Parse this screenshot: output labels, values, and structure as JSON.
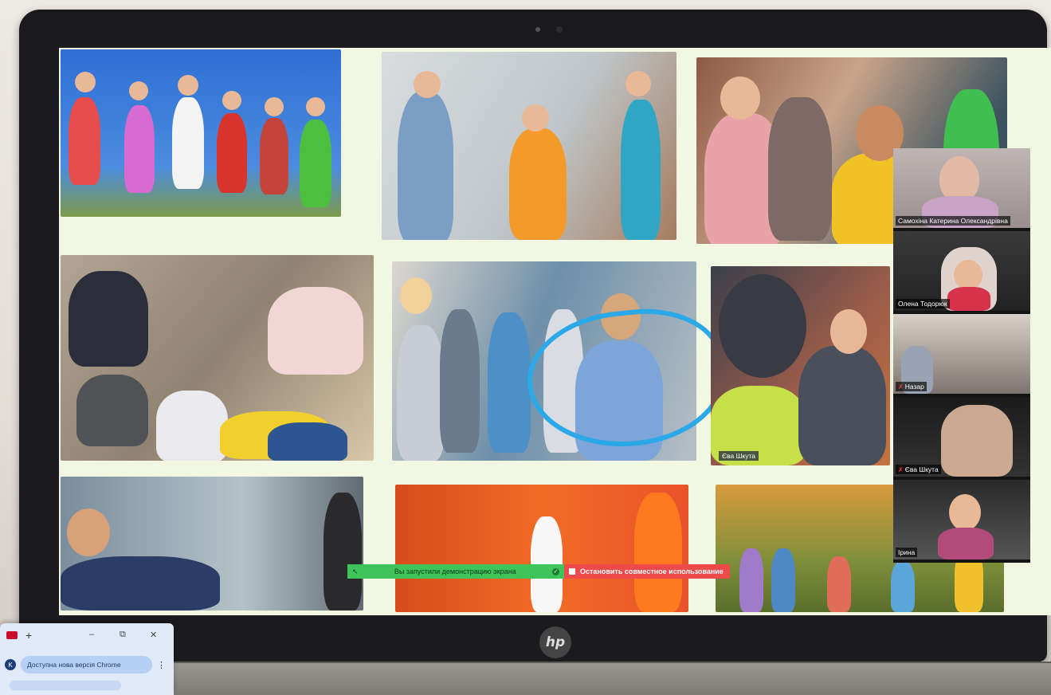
{
  "laptop": {
    "brand_logo": "hp"
  },
  "participants": [
    {
      "name": "Самохіна Катерина Олександрівна",
      "muted": false,
      "active": true
    },
    {
      "name": "Олена Тодорюк",
      "muted": false,
      "active": false
    },
    {
      "name": "Назар",
      "muted": true,
      "active": false
    },
    {
      "name": "Єва Шкута",
      "muted": true,
      "active": false
    },
    {
      "name": "Ірина",
      "muted": false,
      "active": false
    }
  ],
  "tile_label": "Єва Шкута",
  "share_bar": {
    "status_text": "Вы запустили демонстрацию экрана",
    "stop_label": "Остановить совместное использование"
  },
  "chrome_popup": {
    "new_tab_symbol": "+",
    "minimize_symbol": "–",
    "restore_symbol": "⧉",
    "close_symbol": "✕",
    "profile_initial": "K",
    "update_text": "Доступна нова версія Chrome",
    "menu_symbol": "⋮"
  },
  "icons": {
    "pointer-icon": "↖",
    "shield-icon": "✓",
    "mic-muted-icon": "✗"
  },
  "colors": {
    "share_green": "#3ec45a",
    "share_red": "#ee4a4a",
    "annotation_blue": "#2aa8e8",
    "active_speaker": "#7ed321"
  }
}
